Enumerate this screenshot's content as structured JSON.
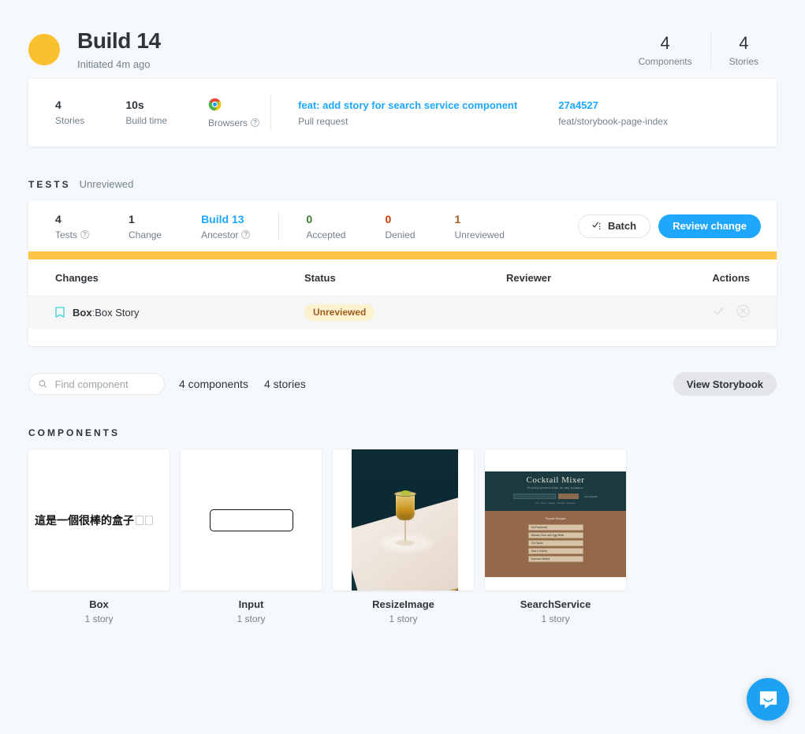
{
  "header": {
    "status_color": "#FBC02D",
    "title": "Build 14",
    "subtitle": "Initiated 4m ago",
    "stats": [
      {
        "value": "4",
        "label": "Components"
      },
      {
        "value": "4",
        "label": "Stories"
      }
    ]
  },
  "info_card": {
    "items": [
      {
        "value": "4",
        "label": "Stories",
        "help": false
      },
      {
        "value": "10s",
        "label": "Build time",
        "help": false
      },
      {
        "value": "chrome-icon",
        "label": "Browsers",
        "help": true
      }
    ],
    "pull_request": {
      "link": "feat: add story for search service component",
      "caption": "Pull request"
    },
    "commit": {
      "link": "27a4527",
      "caption": "feat/storybook-page-index"
    }
  },
  "tests_section": {
    "title": "TESTS",
    "note": "Unreviewed",
    "stats": [
      {
        "value": "4",
        "label": "Tests",
        "help": true,
        "style": "plain"
      },
      {
        "value": "1",
        "label": "Change",
        "help": false,
        "style": "plain"
      },
      {
        "value": "Build 13",
        "label": "Ancestor",
        "help": true,
        "style": "link"
      },
      {
        "value": "0",
        "label": "Accepted",
        "help": false,
        "style": "accepted"
      },
      {
        "value": "0",
        "label": "Denied",
        "help": false,
        "style": "denied"
      },
      {
        "value": "1",
        "label": "Unreviewed",
        "help": false,
        "style": "unreviewed"
      }
    ],
    "batch_label": "Batch",
    "review_label": "Review change",
    "status_bar_color": "#FFC445",
    "table": {
      "columns": [
        "Changes",
        "Status",
        "Reviewer",
        "Actions"
      ],
      "rows": [
        {
          "component": "Box",
          "separator": ":",
          "story": "Box Story",
          "status": "Unreviewed",
          "reviewer": "",
          "actions": [
            "check-icon",
            "circle-x-icon"
          ]
        }
      ]
    }
  },
  "find": {
    "placeholder": "Find component",
    "value": "",
    "components_count": "4 components",
    "stories_count": "4 stories",
    "view_storybook_label": "View Storybook"
  },
  "components_section": {
    "title": "COMPONENTS",
    "items": [
      {
        "name": "Box",
        "stories": "1 story",
        "preview_text": "這是一個很棒的盒子"
      },
      {
        "name": "Input",
        "stories": "1 story"
      },
      {
        "name": "ResizeImage",
        "stories": "1 story"
      },
      {
        "name": "SearchService",
        "stories": "1 story",
        "preview": {
          "title": "Cocktail Mixer",
          "tagline": "Find the perfect drink for any occasion",
          "search_button": "Search",
          "nav_link": "All Cocktails",
          "meta": "Gin · Rum · Vodka · Tequila · Whiskey",
          "body_title": "Popular Recipes",
          "list": [
            "Old Fashioned",
            "Whiskey Sour with Egg White",
            "Gin Gimlet",
            "Dark n Stormy",
            "Espresso Martini"
          ]
        }
      }
    ]
  },
  "intercom": {
    "label": "Open Intercom Messenger"
  }
}
